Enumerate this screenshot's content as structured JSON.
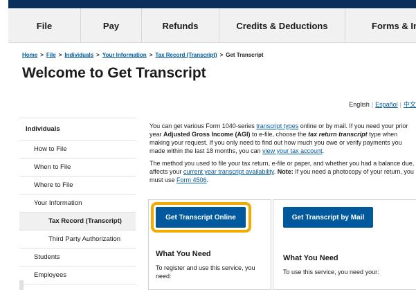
{
  "nav": {
    "items": [
      {
        "label": "File"
      },
      {
        "label": "Pay"
      },
      {
        "label": "Refunds"
      },
      {
        "label": "Credits & Deductions"
      },
      {
        "label": "Forms & In"
      }
    ]
  },
  "breadcrumb": {
    "items": [
      {
        "label": "Home"
      },
      {
        "label": "File"
      },
      {
        "label": "Individuals"
      },
      {
        "label": "Your Information"
      },
      {
        "label": "Tax Record (Transcript)"
      }
    ],
    "current": "Get Transcript",
    "separator": ">"
  },
  "page": {
    "title": "Welcome to Get Transcript"
  },
  "language": {
    "current": "English",
    "options": [
      "Español",
      "中文"
    ]
  },
  "sidebar": {
    "items": [
      {
        "label": "Individuals"
      },
      {
        "label": "How to File"
      },
      {
        "label": "When to File"
      },
      {
        "label": "Where to File"
      },
      {
        "label": "Your Information"
      },
      {
        "label": "Tax Record (Transcript)"
      },
      {
        "label": "Third Party Authorization"
      },
      {
        "label": "Students"
      },
      {
        "label": "Employees"
      }
    ]
  },
  "intro": {
    "p1": {
      "t1": "You can get various Form 1040-series ",
      "link1": "transcript types",
      "t2": " online or by mail. If you need your prior year ",
      "bold1": "Adjusted Gross Income (AGI)",
      "t3": " to e-file, choose the ",
      "bold2": "tax return transcript",
      "t4": " type when making your request. If you only need to find out how much you owe or verify payments you made within the last 18 months, you can ",
      "link2": "view your tax account",
      "t5": "."
    },
    "p2": {
      "t1": "The method you used to file your tax return, e-file or paper, and whether you had a balance due, affects your ",
      "link1": "current year transcript availability",
      "t2": ". ",
      "bold1": "Note:",
      "t3": " If you need a photocopy of your return, you must use ",
      "link2": "Form 4506",
      "t4": "."
    }
  },
  "online_card": {
    "button": "Get Transcript Online",
    "heading": "What You Need",
    "text": "To register and use this service, you need:"
  },
  "mail_card": {
    "button": "Get Transcript by Mail",
    "heading": "What You Need",
    "text": "To use this service, you need your:"
  },
  "colors": {
    "topbar": "#0b2f5b",
    "link": "#00599c",
    "button": "#00599c",
    "highlight": "#f2a900"
  }
}
